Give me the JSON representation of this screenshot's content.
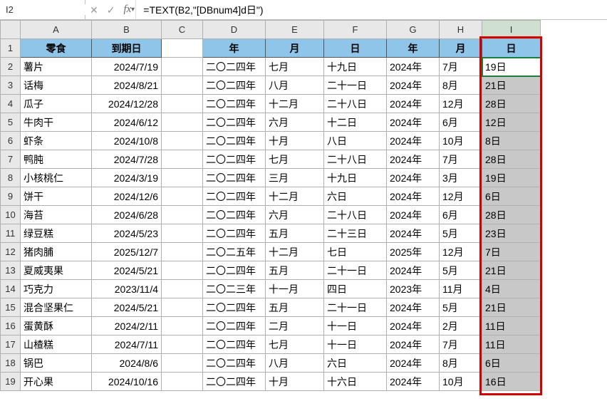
{
  "name_box": "I2",
  "formula": "=TEXT(B2,\"[DBnum4]d日\")",
  "col_headers": [
    "A",
    "B",
    "C",
    "D",
    "E",
    "F",
    "G",
    "H",
    "I"
  ],
  "user_headers": {
    "A": "零食",
    "B": "到期日",
    "D": "年",
    "E": "月",
    "F": "日",
    "G": "年",
    "H": "月",
    "I": "日"
  },
  "rows": [
    {
      "r": 2,
      "A": "薯片",
      "B": "2024/7/19",
      "D": "二〇二四年",
      "E": "七月",
      "F": "十九日",
      "G": "2024年",
      "H": "7月",
      "I": "19日"
    },
    {
      "r": 3,
      "A": "话梅",
      "B": "2024/8/21",
      "D": "二〇二四年",
      "E": "八月",
      "F": "二十一日",
      "G": "2024年",
      "H": "8月",
      "I": "21日"
    },
    {
      "r": 4,
      "A": "瓜子",
      "B": "2024/12/28",
      "D": "二〇二四年",
      "E": "十二月",
      "F": "二十八日",
      "G": "2024年",
      "H": "12月",
      "I": "28日"
    },
    {
      "r": 5,
      "A": "牛肉干",
      "B": "2024/6/12",
      "D": "二〇二四年",
      "E": "六月",
      "F": "十二日",
      "G": "2024年",
      "H": "6月",
      "I": "12日"
    },
    {
      "r": 6,
      "A": "虾条",
      "B": "2024/10/8",
      "D": "二〇二四年",
      "E": "十月",
      "F": "八日",
      "G": "2024年",
      "H": "10月",
      "I": "8日"
    },
    {
      "r": 7,
      "A": "鸭肫",
      "B": "2024/7/28",
      "D": "二〇二四年",
      "E": "七月",
      "F": "二十八日",
      "G": "2024年",
      "H": "7月",
      "I": "28日"
    },
    {
      "r": 8,
      "A": "小核桃仁",
      "B": "2024/3/19",
      "D": "二〇二四年",
      "E": "三月",
      "F": "十九日",
      "G": "2024年",
      "H": "3月",
      "I": "19日"
    },
    {
      "r": 9,
      "A": "饼干",
      "B": "2024/12/6",
      "D": "二〇二四年",
      "E": "十二月",
      "F": "六日",
      "G": "2024年",
      "H": "12月",
      "I": "6日"
    },
    {
      "r": 10,
      "A": "海苔",
      "B": "2024/6/28",
      "D": "二〇二四年",
      "E": "六月",
      "F": "二十八日",
      "G": "2024年",
      "H": "6月",
      "I": "28日"
    },
    {
      "r": 11,
      "A": "绿豆糕",
      "B": "2024/5/23",
      "D": "二〇二四年",
      "E": "五月",
      "F": "二十三日",
      "G": "2024年",
      "H": "5月",
      "I": "23日"
    },
    {
      "r": 12,
      "A": "猪肉脯",
      "B": "2025/12/7",
      "D": "二〇二五年",
      "E": "十二月",
      "F": "七日",
      "G": "2025年",
      "H": "12月",
      "I": "7日"
    },
    {
      "r": 13,
      "A": "夏威夷果",
      "B": "2024/5/21",
      "D": "二〇二四年",
      "E": "五月",
      "F": "二十一日",
      "G": "2024年",
      "H": "5月",
      "I": "21日"
    },
    {
      "r": 14,
      "A": "巧克力",
      "B": "2023/11/4",
      "D": "二〇二三年",
      "E": "十一月",
      "F": "四日",
      "G": "2023年",
      "H": "11月",
      "I": "4日"
    },
    {
      "r": 15,
      "A": "混合坚果仁",
      "B": "2024/5/21",
      "D": "二〇二四年",
      "E": "五月",
      "F": "二十一日",
      "G": "2024年",
      "H": "5月",
      "I": "21日"
    },
    {
      "r": 16,
      "A": "蛋黄酥",
      "B": "2024/2/11",
      "D": "二〇二四年",
      "E": "二月",
      "F": "十一日",
      "G": "2024年",
      "H": "2月",
      "I": "11日"
    },
    {
      "r": 17,
      "A": "山楂糕",
      "B": "2024/7/11",
      "D": "二〇二四年",
      "E": "七月",
      "F": "十一日",
      "G": "2024年",
      "H": "7月",
      "I": "11日"
    },
    {
      "r": 18,
      "A": "锅巴",
      "B": "2024/8/6",
      "D": "二〇二四年",
      "E": "八月",
      "F": "六日",
      "G": "2024年",
      "H": "8月",
      "I": "6日"
    },
    {
      "r": 19,
      "A": "开心果",
      "B": "2024/10/16",
      "D": "二〇二四年",
      "E": "十月",
      "F": "十六日",
      "G": "2024年",
      "H": "10月",
      "I": "16日"
    }
  ]
}
